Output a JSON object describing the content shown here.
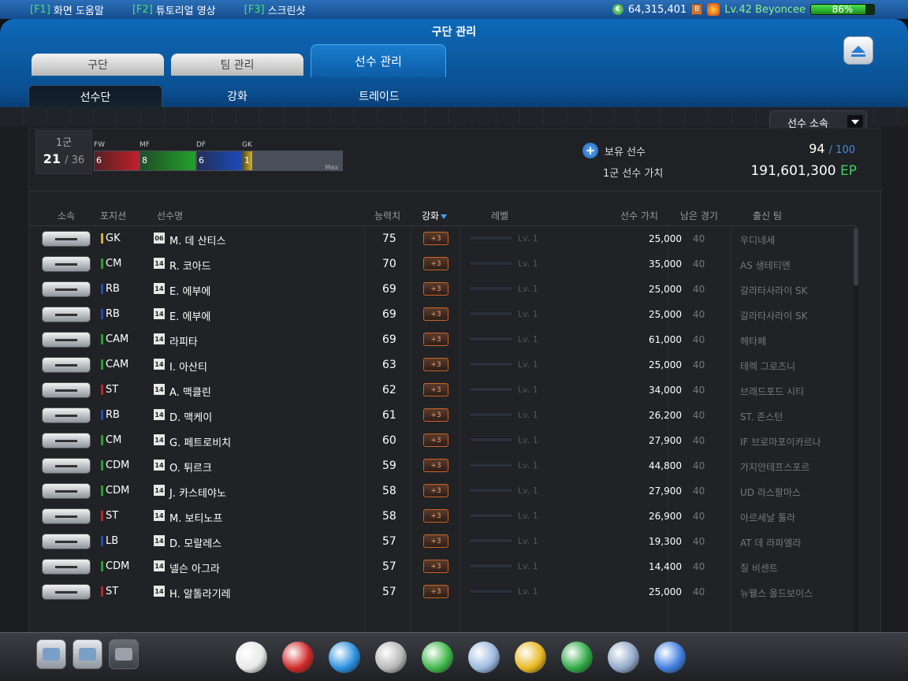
{
  "hotkeys": [
    {
      "key": "[F1]",
      "label": "화면 도움말"
    },
    {
      "key": "[F2]",
      "label": "튜토리얼 영상"
    },
    {
      "key": "[F3]",
      "label": "스크린샷"
    }
  ],
  "account": {
    "coins": "64,315,401",
    "level": "Lv.42 Beyoncee",
    "progress_pct": 86,
    "progress_label": "86%",
    "coin_glyph": "€",
    "rank_glyph": "B"
  },
  "window": {
    "title": "구단 관리"
  },
  "tabs": {
    "squad": "구단",
    "team": "팀 관리",
    "player": "선수 관리"
  },
  "subtabs": {
    "roster": "선수단",
    "enhance": "강화",
    "trade": "트레이드"
  },
  "filter": {
    "label": "선수 소속"
  },
  "group": {
    "name": "1군",
    "count": "21",
    "max": "36"
  },
  "positions": [
    {
      "label": "FW",
      "count": "6",
      "color": "#c0202a"
    },
    {
      "label": "MF",
      "count": "8",
      "color": "#22a22c"
    },
    {
      "label": "DF",
      "count": "6",
      "color": "#1f4ab8"
    },
    {
      "label": "GK",
      "count": "1",
      "color": "#d4b020"
    }
  ],
  "max_label": "Max",
  "summary": {
    "owned_label": "보유 선수",
    "owned": "94",
    "owned_max": "100",
    "value_label": "1군 선수 가치",
    "value": "191,601,300",
    "currency": "EP"
  },
  "columns": {
    "affil": "소속",
    "position": "포지션",
    "name": "선수명",
    "ovr": "능력치",
    "enhance": "강화",
    "level": "레벨",
    "value": "선수 가치",
    "games": "남은 경기",
    "club": "출신 팀"
  },
  "players": [
    {
      "pos": "GK",
      "poscolor": "#d4b020",
      "season": "06",
      "name": "M. 데 산티스",
      "ovr": "75",
      "enh": "+3",
      "lv": "Lv. 1",
      "value": "25,000",
      "games": "40",
      "club": "우디네세"
    },
    {
      "pos": "CM",
      "poscolor": "#22a22c",
      "season": "14",
      "name": "R. 코아드",
      "ovr": "70",
      "enh": "+3",
      "lv": "Lv. 1",
      "value": "35,000",
      "games": "40",
      "club": "AS 생테티엔"
    },
    {
      "pos": "RB",
      "poscolor": "#1f4ab8",
      "season": "14",
      "name": "E. 에부에",
      "ovr": "69",
      "enh": "+3",
      "lv": "Lv. 1",
      "value": "25,000",
      "games": "40",
      "club": "갈라타사라이 SK"
    },
    {
      "pos": "RB",
      "poscolor": "#1f4ab8",
      "season": "14",
      "name": "E. 에부에",
      "ovr": "69",
      "enh": "+3",
      "lv": "Lv. 1",
      "value": "25,000",
      "games": "40",
      "club": "갈라타사라이 SK"
    },
    {
      "pos": "CAM",
      "poscolor": "#22a22c",
      "season": "14",
      "name": "라피타",
      "ovr": "69",
      "enh": "+3",
      "lv": "Lv. 1",
      "value": "61,000",
      "games": "40",
      "club": "헤타페"
    },
    {
      "pos": "CAM",
      "poscolor": "#22a22c",
      "season": "14",
      "name": "I. 아산티",
      "ovr": "63",
      "enh": "+3",
      "lv": "Lv. 1",
      "value": "25,000",
      "games": "40",
      "club": "테렉 그로즈니"
    },
    {
      "pos": "ST",
      "poscolor": "#c0202a",
      "season": "14",
      "name": "A. 맥클린",
      "ovr": "62",
      "enh": "+3",
      "lv": "Lv. 1",
      "value": "34,000",
      "games": "40",
      "club": "브래드포드 시티"
    },
    {
      "pos": "RB",
      "poscolor": "#1f4ab8",
      "season": "14",
      "name": "D. 맥케이",
      "ovr": "61",
      "enh": "+3",
      "lv": "Lv. 1",
      "value": "26,200",
      "games": "40",
      "club": "ST. 존스턴"
    },
    {
      "pos": "CM",
      "poscolor": "#22a22c",
      "season": "14",
      "name": "G. 페트로비치",
      "ovr": "60",
      "enh": "+3",
      "lv": "Lv. 1",
      "value": "27,900",
      "games": "40",
      "club": "IF 브로마포이카르나"
    },
    {
      "pos": "CDM",
      "poscolor": "#22a22c",
      "season": "14",
      "name": "O. 튀르크",
      "ovr": "59",
      "enh": "+3",
      "lv": "Lv. 1",
      "value": "44,800",
      "games": "40",
      "club": "가지안테프스포르"
    },
    {
      "pos": "CDM",
      "poscolor": "#22a22c",
      "season": "14",
      "name": "J. 카스테야노",
      "ovr": "58",
      "enh": "+3",
      "lv": "Lv. 1",
      "value": "27,900",
      "games": "40",
      "club": "UD 라스팔마스"
    },
    {
      "pos": "ST",
      "poscolor": "#c0202a",
      "season": "14",
      "name": "M. 보티노프",
      "ovr": "58",
      "enh": "+3",
      "lv": "Lv. 1",
      "value": "26,900",
      "games": "40",
      "club": "아르세날 툴라"
    },
    {
      "pos": "LB",
      "poscolor": "#1f4ab8",
      "season": "14",
      "name": "D. 모랄레스",
      "ovr": "57",
      "enh": "+3",
      "lv": "Lv. 1",
      "value": "19,300",
      "games": "40",
      "club": "AT 데 라파엘라"
    },
    {
      "pos": "CDM",
      "poscolor": "#22a22c",
      "season": "14",
      "name": "넬슨 아그라",
      "ovr": "57",
      "enh": "+3",
      "lv": "Lv. 1",
      "value": "14,400",
      "games": "40",
      "club": "질 비센트"
    },
    {
      "pos": "ST",
      "poscolor": "#c0202a",
      "season": "14",
      "name": "H. 알톨라기레",
      "ovr": "57",
      "enh": "+3",
      "lv": "Lv. 1",
      "value": "25,000",
      "games": "40",
      "club": "뉴웰스 올드보이스"
    }
  ],
  "sidebuttons": [
    "chat-icon",
    "messenger-icon",
    "mail-icon"
  ],
  "dock": [
    "whistle-icon",
    "ball-icon",
    "boots-icon",
    "trophy-icon",
    "ranking-icon",
    "clipboard-icon",
    "jersey-icon",
    "club-icon",
    "card-icon",
    "cart-icon"
  ]
}
